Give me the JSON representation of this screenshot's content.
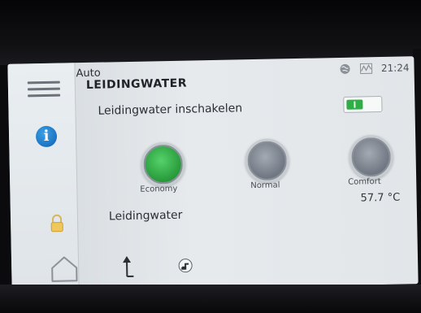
{
  "status_bar": {
    "mode": "Auto",
    "time": "21:24",
    "icons": [
      "globe-icon",
      "chart-icon"
    ]
  },
  "page": {
    "title": "LEIDINGWATER"
  },
  "toggle_row": {
    "label": "Leidingwater inschakelen",
    "enabled": true,
    "accent_color": "#2fae46"
  },
  "modes": [
    {
      "label": "Economy",
      "selected": true,
      "color": "#34b24a"
    },
    {
      "label": "Normal",
      "selected": false,
      "color": "#7b818b"
    },
    {
      "label": "Comfort",
      "selected": false,
      "color": "#7b818b"
    }
  ],
  "section": {
    "label": "Leidingwater",
    "temperature": "57.7 °C"
  },
  "sidebar": {
    "icons": [
      "menu-icon",
      "info-icon",
      "lock-icon",
      "home-icon"
    ]
  },
  "bottom_bar": {
    "icons": [
      "arrow-up-icon",
      "tap-icon"
    ]
  }
}
